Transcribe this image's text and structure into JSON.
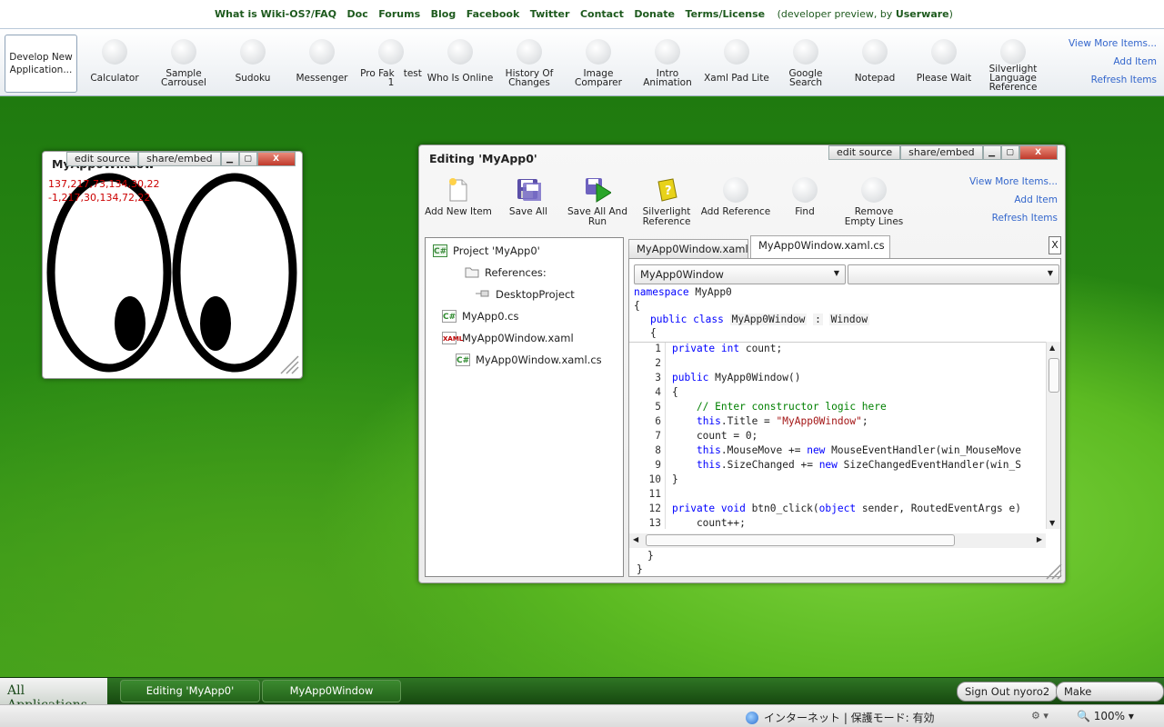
{
  "topnav": {
    "links": [
      "What is Wiki-OS?/FAQ",
      "Doc",
      "Forums",
      "Blog",
      "Facebook",
      "Twitter",
      "Contact",
      "Donate",
      "Terms/License"
    ],
    "dev_prefix": "(developer preview, by ",
    "dev_author": "Userware",
    "dev_suffix": ")"
  },
  "appbar": {
    "develop_button": "Develop New Application...",
    "apps": [
      "Calculator",
      "Sample Carrousel",
      "Sudoku",
      "Messenger",
      "Pro Fak   test 1",
      "Who Is Online",
      "History Of Changes",
      "Image Comparer",
      "Intro Animation",
      "Xaml Pad Lite",
      "Google Search",
      "Notepad",
      "Please Wait",
      "Silverlight Language Reference"
    ],
    "links": [
      "View More Items...",
      "Add Item",
      "Refresh Items"
    ]
  },
  "eyes_window": {
    "title": "MyApp0Window",
    "edit_source": "edit source",
    "share_embed": "share/embed",
    "coords_line1": "137,217,73,134,30,22",
    "coords_line2": "-1,217,30,134,72,22"
  },
  "editor": {
    "title": "Editing 'MyApp0'",
    "edit_source": "edit source",
    "share_embed": "share/embed",
    "toolbar": [
      "Add New Item",
      "Save All",
      "Save All And Run",
      "Silverlight Reference",
      "Add Reference",
      "Find",
      "Remove Empty Lines"
    ],
    "links": [
      "View More Items...",
      "Add Item",
      "Refresh Items"
    ],
    "tree": {
      "project": "Project 'MyApp0'",
      "references": "References:",
      "desktop_project": "DesktopProject",
      "file1": "MyApp0.cs",
      "file2": "MyApp0Window.xaml",
      "file3": "MyApp0Window.xaml.cs"
    },
    "tabs": [
      "MyApp0Window.xaml",
      "MyApp0Window.xaml.cs"
    ],
    "close_tab": "X",
    "class_combo": "MyApp0Window",
    "member_combo": "",
    "code_header": {
      "namespace_kw": "namespace",
      "namespace_name": "MyApp0",
      "brace_open": "{",
      "class_kw": "public class",
      "class_name": "MyApp0Window",
      "colon": ":",
      "base": "Window",
      "class_brace": "{"
    },
    "line_numbers": [
      "1",
      "2",
      "3",
      "4",
      "5",
      "6",
      "7",
      "8",
      "9",
      "10",
      "11",
      "12",
      "13"
    ],
    "code_lines": {
      "l1_kw": "private int",
      "l1_rest": " count;",
      "l3_kw": "public",
      "l3_rest": " MyApp0Window()",
      "l4": "{",
      "l5": "    // Enter constructor logic here",
      "l6_kw": "this",
      "l6_a": ".Title = ",
      "l6_str": "\"MyApp0Window\"",
      "l6_b": ";",
      "l7": "    count = 0;",
      "l8_kw": "this",
      "l8_a": ".MouseMove += ",
      "l8_new": "new",
      "l8_b": " MouseEventHandler(win_MouseMove",
      "l9_kw": "this",
      "l9_a": ".SizeChanged += ",
      "l9_new": "new",
      "l9_b": " SizeChangedEventHandler(win_S",
      "l10": "}",
      "l12_kw": "private void",
      "l12_a": " btn0_click(",
      "l12_obj": "object",
      "l12_b": " sender, RoutedEventArgs e)",
      "l13": "    count++;"
    },
    "footer_brace1": "}",
    "footer_brace2": "}"
  },
  "taskbar": {
    "all_apps": "All Applications",
    "tasks": [
      "Editing 'MyApp0'",
      "MyApp0Window"
    ],
    "sign_out": "Sign Out nyoro2",
    "suggest": "Make Suggestions"
  },
  "statusbar": {
    "zone": "インターネット | 保護モード: 有効",
    "zoom": "100%"
  }
}
